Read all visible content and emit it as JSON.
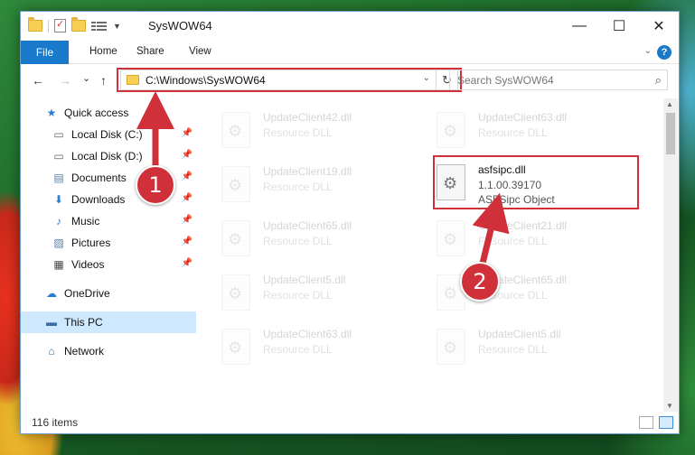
{
  "window": {
    "title": "SysWOW64",
    "minimize_glyph": "—",
    "maximize_glyph": "☐",
    "close_glyph": "✕"
  },
  "ribbon": {
    "file_tab": "File",
    "tabs": [
      "Home",
      "Share",
      "View"
    ]
  },
  "navigation": {
    "back_glyph": "←",
    "forward_glyph": "→",
    "recent_glyph": "⌄",
    "up_glyph": "↑",
    "address_path": "C:\\Windows\\SysWOW64",
    "search_placeholder": "Search SysWOW64"
  },
  "sidebar": {
    "items": [
      {
        "label": "Quick access",
        "icon": "star-icon",
        "glyph": "★"
      },
      {
        "label": "Local Disk (C:)",
        "icon": "drive-icon",
        "glyph": "▭"
      },
      {
        "label": "Local Disk (D:)",
        "icon": "drive-icon",
        "glyph": "▭"
      },
      {
        "label": "Documents",
        "icon": "documents-icon",
        "glyph": "▤"
      },
      {
        "label": "Downloads",
        "icon": "downloads-icon",
        "glyph": "⬇"
      },
      {
        "label": "Music",
        "icon": "music-icon",
        "glyph": "♪"
      },
      {
        "label": "Pictures",
        "icon": "pictures-icon",
        "glyph": "▨"
      },
      {
        "label": "Videos",
        "icon": "videos-icon",
        "glyph": "▦"
      },
      {
        "label": "OneDrive",
        "icon": "cloud-icon",
        "glyph": "☁"
      },
      {
        "label": "This PC",
        "icon": "computer-icon",
        "glyph": "▬"
      },
      {
        "label": "Network",
        "icon": "network-icon",
        "glyph": "⌂"
      }
    ]
  },
  "files": {
    "left": [
      {
        "name": "UpdateClient42.dll",
        "type": "Resource DLL"
      },
      {
        "name": "UpdateClient19.dll",
        "type": "Resource DLL"
      },
      {
        "name": "UpdateClient65.dll",
        "type": "Resource DLL"
      },
      {
        "name": "UpdateClient5.dll",
        "type": "Resource DLL"
      },
      {
        "name": "UpdateClient63.dll",
        "type": "Resource DLL"
      }
    ],
    "right": [
      {
        "name": "UpdateClient63.dll",
        "type": "Resource DLL"
      },
      {
        "name": "UpdateClient21.dll",
        "type": "Resource DLL"
      },
      {
        "name": "UpdateClient65.dll",
        "type": "Resource DLL"
      },
      {
        "name": "UpdateClient5.dll",
        "type": "Resource DLL"
      }
    ],
    "highlighted": {
      "name": "asfsipc.dll",
      "version": "1.1.00.39170",
      "description": "ASFSipc Object"
    }
  },
  "status": {
    "item_count": "116 items"
  },
  "callouts": [
    "1",
    "2"
  ],
  "colors": {
    "accent": "#1979ca",
    "highlight": "#d0303a",
    "selected": "#cde8ff"
  }
}
